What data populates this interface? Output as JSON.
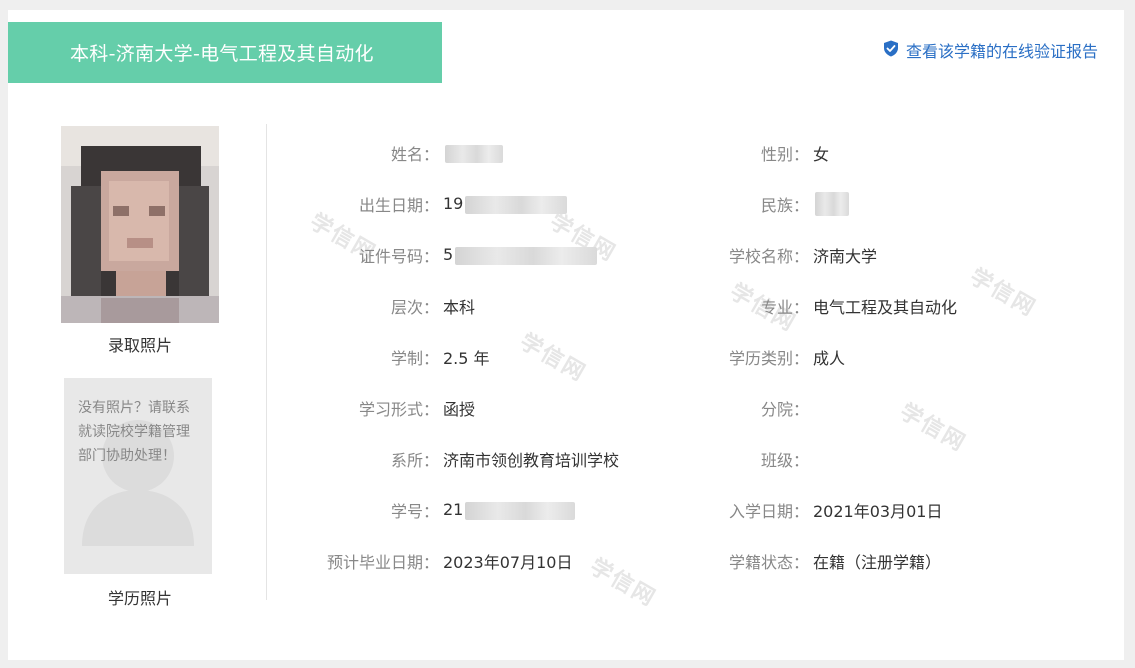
{
  "header": {
    "title": "本科-济南大学-电气工程及其自动化",
    "verify_link": "查看该学籍的在线验证报告"
  },
  "watermark_text": "学信网",
  "photos": {
    "admission_caption": "录取照片",
    "education_caption": "学历照片",
    "no_photo_text": "没有照片？请联系就读院校学籍管理部门协助处理！"
  },
  "fields": {
    "name": {
      "label": "姓名：",
      "value": ""
    },
    "gender": {
      "label": "性别：",
      "value": "女"
    },
    "birth_date": {
      "label": "出生日期：",
      "value": "19"
    },
    "ethnicity": {
      "label": "民族：",
      "value": ""
    },
    "id_number": {
      "label": "证件号码：",
      "value": "5"
    },
    "school": {
      "label": "学校名称：",
      "value": "济南大学"
    },
    "level": {
      "label": "层次：",
      "value": "本科"
    },
    "major": {
      "label": "专业：",
      "value": "电气工程及其自动化"
    },
    "duration": {
      "label": "学制：",
      "value": "2.5 年"
    },
    "education_type": {
      "label": "学历类别：",
      "value": "成人"
    },
    "study_form": {
      "label": "学习形式：",
      "value": "函授"
    },
    "branch": {
      "label": "分院：",
      "value": ""
    },
    "department": {
      "label": "系所：",
      "value": "济南市领创教育培训学校"
    },
    "class": {
      "label": "班级：",
      "value": ""
    },
    "student_id": {
      "label": "学号：",
      "value": "21"
    },
    "enroll_date": {
      "label": "入学日期：",
      "value": "2021年03月01日"
    },
    "expected_grad": {
      "label": "预计毕业日期：",
      "value": "2023年07月10日"
    },
    "status": {
      "label": "学籍状态：",
      "value": "在籍（注册学籍）"
    }
  },
  "colors": {
    "title_bar": "#65ceaa",
    "link": "#2a6fc5"
  }
}
